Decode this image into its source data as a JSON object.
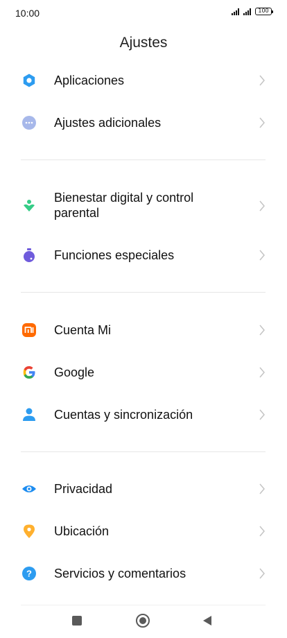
{
  "status": {
    "time": "10:00",
    "battery": "100"
  },
  "header": {
    "title": "Ajustes"
  },
  "items": [
    {
      "label": "Aplicaciones",
      "icon": "gear-icon",
      "color": "#2d9cf0"
    },
    {
      "label": "Ajustes adicionales",
      "icon": "more-icon",
      "color": "#9fb4e8"
    },
    {
      "label": "Bienestar digital y control",
      "label2": "parental",
      "icon": "wellbeing-icon",
      "color": "#35cc86"
    },
    {
      "label": "Funciones especiales",
      "icon": "special-features-icon",
      "color": "#6f5bdc"
    },
    {
      "label": "Cuenta Mi",
      "icon": "mi-account-icon",
      "color": "#ff6a00"
    },
    {
      "label": "Google",
      "icon": "google-icon",
      "color": "#4285f4"
    },
    {
      "label": "Cuentas y sincronización",
      "icon": "account-sync-icon",
      "color": "#2d9cf0"
    },
    {
      "label": "Privacidad",
      "icon": "eye-icon",
      "color": "#1c8cf0"
    },
    {
      "label": "Ubicación",
      "icon": "location-pin-icon",
      "color": "#ffb02e"
    },
    {
      "label": "Servicios y comentarios",
      "icon": "help-icon",
      "color": "#2d9cf0"
    }
  ]
}
